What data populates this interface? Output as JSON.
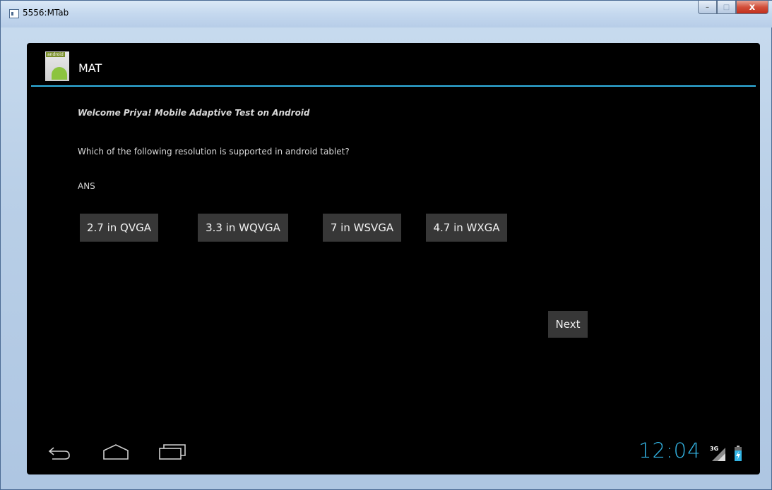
{
  "window": {
    "title": "5556:MTab",
    "minimize_glyph": "–",
    "maximize_glyph": "□",
    "close_glyph": "x"
  },
  "app": {
    "launcher_label": "android",
    "title": "MAT"
  },
  "content": {
    "welcome": "Welcome Priya! Mobile Adaptive Test on Android",
    "question": "Which of the following resolution is supported in android tablet?",
    "ans_label": "ANS",
    "options": [
      "2.7 in QVGA",
      "3.3 in WQVGA",
      "7 in WSVGA",
      "4.7 in WXGA"
    ],
    "next_label": "Next"
  },
  "statusbar": {
    "time": "12:04",
    "network": "3G"
  },
  "colors": {
    "accent": "#33b5e5",
    "button_bg": "#373737",
    "screen_bg": "#000000"
  },
  "icons": [
    "back-icon",
    "home-icon",
    "recent-apps-icon",
    "signal-icon",
    "battery-charging-icon",
    "android-launcher-icon",
    "window-app-icon"
  ]
}
